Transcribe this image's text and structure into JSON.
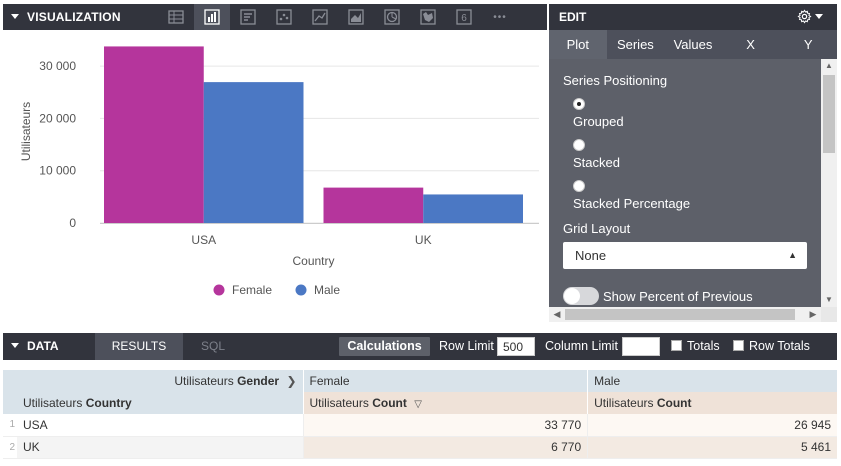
{
  "visualization": {
    "title": "VISUALIZATION",
    "more": "•••",
    "icons": [
      "table-icon",
      "column-chart-icon",
      "single-value-icon",
      "scatter-icon",
      "line-chart-icon",
      "area-chart-icon",
      "pie-chart-icon",
      "map-icon",
      "number-six-icon",
      "more-icon"
    ],
    "six_label": "6"
  },
  "chart_data": {
    "type": "bar",
    "categories": [
      "USA",
      "UK"
    ],
    "series": [
      {
        "name": "Female",
        "values": [
          33770,
          6770
        ],
        "color": "#b5359c"
      },
      {
        "name": "Male",
        "values": [
          26945,
          5461
        ],
        "color": "#4b78c4"
      }
    ],
    "xlabel": "Country",
    "ylabel": "Utilisateurs",
    "ylim": [
      0,
      35000
    ],
    "yticks": [
      0,
      10000,
      20000,
      30000
    ],
    "ytick_labels": [
      "0",
      "10 000",
      "20 000",
      "30 000"
    ],
    "grid": true,
    "legend": "bottom-center"
  },
  "edit": {
    "title": "EDIT",
    "tabs": [
      "Plot",
      "Series",
      "Values",
      "X",
      "Y"
    ],
    "active_tab": "Plot",
    "series_positioning_label": "Series Positioning",
    "positioning_options": [
      "Grouped",
      "Stacked",
      "Stacked Percentage"
    ],
    "selected_positioning": "Grouped",
    "grid_layout_label": "Grid Layout",
    "grid_layout_value": "None",
    "show_percent_label": "Show Percent of Previous"
  },
  "data": {
    "title": "DATA",
    "tab_results": "RESULTS",
    "tab_sql": "SQL",
    "calculations": "Calculations",
    "row_limit_label": "Row Limit",
    "row_limit_value": "500",
    "column_limit_label": "Column Limit",
    "column_limit_value": "",
    "totals_label": "Totals",
    "row_totals_label": "Row Totals"
  },
  "table": {
    "pivot_prefix": "Utilisateurs",
    "pivot_field": "Gender",
    "pivot_values": [
      "Female",
      "Male"
    ],
    "dim_prefix": "Utilisateurs",
    "dim_field": "Country",
    "measure_prefix": "Utilisateurs",
    "measure_field": "Count",
    "rows": [
      {
        "num": "1",
        "country": "USA",
        "female": "33 770",
        "male": "26 945"
      },
      {
        "num": "2",
        "country": "UK",
        "female": "6 770",
        "male": "5 461"
      }
    ]
  }
}
